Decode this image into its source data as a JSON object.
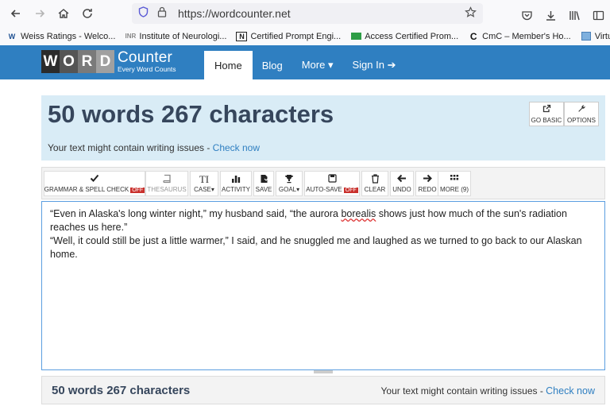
{
  "browser": {
    "url": "https://wordcounter.net",
    "bookmarks": [
      {
        "label": "Weiss Ratings - Welco..."
      },
      {
        "label": "Institute of Neurologi..."
      },
      {
        "label": "Certified Prompt Engi..."
      },
      {
        "label": "Access Certified Prom..."
      },
      {
        "label": "CmC – Member's Ho..."
      },
      {
        "label": "Virtual Business"
      }
    ]
  },
  "site": {
    "logo_letters": [
      "W",
      "O",
      "R",
      "D"
    ],
    "logo_counter": "Counter",
    "logo_tagline": "Every Word Counts",
    "nav": [
      {
        "label": "Home"
      },
      {
        "label": "Blog"
      },
      {
        "label": "More ▾"
      },
      {
        "label": "Sign In ➔"
      }
    ]
  },
  "headline": {
    "title": "50 words 267 characters",
    "issues_prefix": "Your text might contain writing issues - ",
    "issues_link": "Check now",
    "go_basic": "GO BASIC",
    "options": "OPTIONS"
  },
  "tools": [
    {
      "label": "GRAMMAR & SPELL CHECK",
      "badge": "OFF"
    },
    {
      "label": "THESAURUS"
    },
    {
      "label": "CASE▾"
    },
    {
      "label": "ACTIVITY"
    },
    {
      "label": "SAVE"
    },
    {
      "label": "GOAL▾"
    },
    {
      "label": "AUTO-SAVE",
      "badge": "OFF"
    },
    {
      "label": "CLEAR"
    },
    {
      "label": "UNDO"
    },
    {
      "label": "REDO"
    },
    {
      "label": "MORE (9)"
    }
  ],
  "editor": {
    "line1_pre": "“Even in Alaska's long winter night,” my husband said, “the aurora ",
    "line1_misspelled": "borealis",
    "line1_post": " shows just how much of the sun's radiation reaches us here.”",
    "line2": "“Well, it could still be just a little warmer,” I said, and he snuggled me and laughed as we turned to go back to our Alaskan home."
  },
  "footer": {
    "count": "50 words 267 characters",
    "issues_prefix": "Your text might contain writing issues - ",
    "issues_link": "Check now"
  },
  "colors": {
    "header_blue": "#2f7fc1",
    "headline_bg": "#d9ecf6",
    "off_badge": "#c9302c"
  }
}
